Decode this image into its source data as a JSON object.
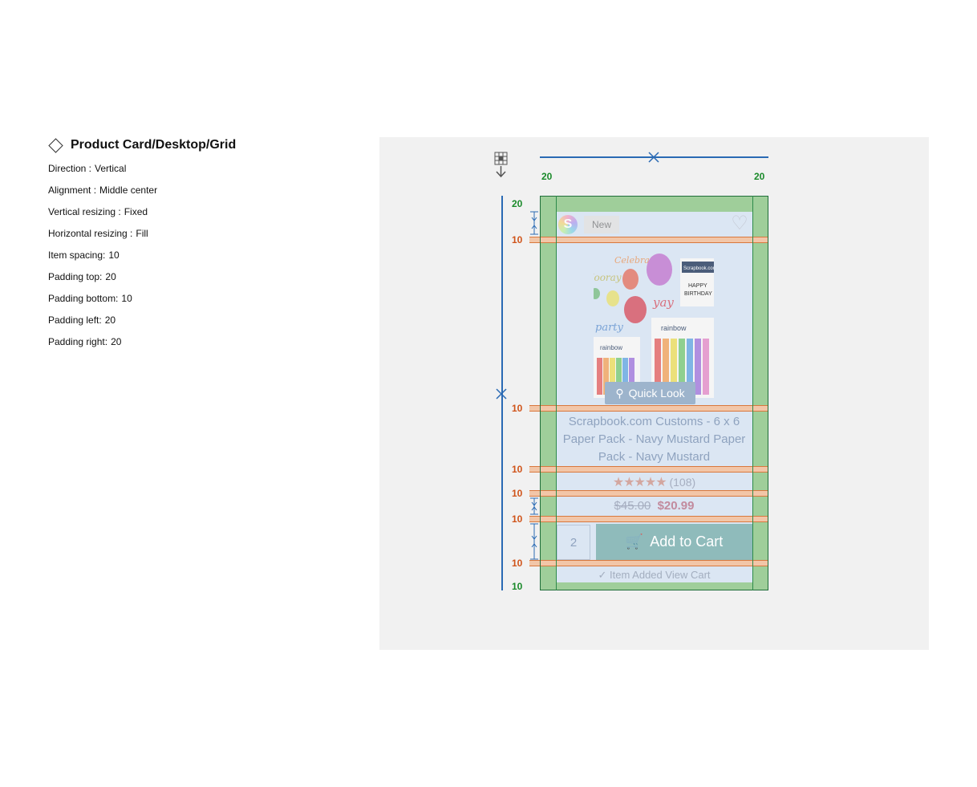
{
  "spec": {
    "title": "Product Card/Desktop/Grid",
    "rows": [
      {
        "key": "Direction :",
        "value": "Vertical"
      },
      {
        "key": "Alignment :",
        "value": "Middle center"
      },
      {
        "key": "Vertical resizing :",
        "value": "Fixed"
      },
      {
        "key": "Horizontal resizing :",
        "value": "Fill"
      },
      {
        "key": "Item spacing:",
        "value": "10"
      },
      {
        "key": "Padding top:",
        "value": "20"
      },
      {
        "key": "Padding bottom:",
        "value": "10"
      },
      {
        "key": "Padding left:",
        "value": "20"
      },
      {
        "key": "Padding right:",
        "value": "20"
      }
    ]
  },
  "measurements": {
    "padding_left": "20",
    "padding_right": "20",
    "padding_top": "20",
    "padding_bottom": "10",
    "gaps": [
      "10",
      "10",
      "10",
      "10",
      "10",
      "10"
    ]
  },
  "card": {
    "badge": "New",
    "quick_look": "Quick Look",
    "title": "Scrapbook.com Customs - 6 x 6 Paper Pack - Navy Mustard Paper Pack - Navy Mustard",
    "rating_count": "(108)",
    "price_old": "$45.00",
    "price_new": "$20.99",
    "quantity": "2",
    "add_to_cart": "Add to Cart",
    "item_added": "Item Added",
    "view_cart": "View Cart"
  },
  "colors": {
    "padding": "#9fce9a",
    "gap": "#f2c6a8",
    "content": "#dbe6f3",
    "measure_line": "#2a6ab4",
    "padding_label": "#1a8a2a",
    "gap_label": "#d0541a"
  }
}
